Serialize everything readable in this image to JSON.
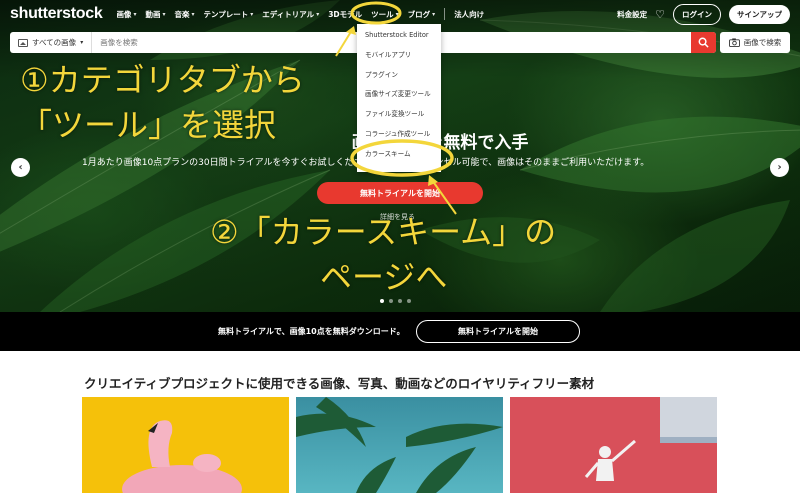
{
  "nav": {
    "logo": "shutterstock",
    "items": [
      {
        "label": "画像",
        "has_chevron": true
      },
      {
        "label": "動画",
        "has_chevron": true
      },
      {
        "label": "音楽",
        "has_chevron": true
      },
      {
        "label": "テンプレート",
        "has_chevron": true
      },
      {
        "label": "エディトリアル",
        "has_chevron": true
      },
      {
        "label": "3Dモデル",
        "has_chevron": false
      },
      {
        "label": "ツール",
        "has_chevron": true
      },
      {
        "label": "ブログ",
        "has_chevron": true
      },
      {
        "label": "法人向け",
        "has_chevron": false
      }
    ],
    "pricing": "料金設定",
    "login": "ログイン",
    "signup": "サインアップ"
  },
  "search": {
    "type_label": "すべての画像",
    "placeholder": "画像を検索",
    "image_search": "画像で検索"
  },
  "tools_menu": {
    "items": [
      "Shutterstock Editor",
      "モバイルアプリ",
      "プラグイン",
      "画像サイズ変更ツール",
      "ファイル変換ツール",
      "コラージュ作成ツール",
      "カラースキーム"
    ]
  },
  "hero": {
    "title": "画像10点を無料で入手",
    "subtitle": "1月あたり画像10点プランの30日間トライアルを今すぐお試しください。いつでもキャンセル可能で、画像はそのままご利用いただけます。",
    "cta": "無料トライアルを開始",
    "details": "詳細を見る"
  },
  "annotations": {
    "step1_line1": "①カテゴリタブから",
    "step1_line2": "「ツール」を選択",
    "step2_line1": "②「カラースキーム」の",
    "step2_line2": "ページへ",
    "color": "#f3d63b"
  },
  "promo": {
    "text": "無料トライアルで、画像10点を無料ダウンロード。",
    "button": "無料トライアルを開始"
  },
  "section": {
    "title": "クリエイティブプロジェクトに使用できる画像、写真、動画などのロイヤリティフリー素材"
  },
  "colors": {
    "accent_red": "#e8392f",
    "highlight_yellow": "#f3d63b"
  }
}
